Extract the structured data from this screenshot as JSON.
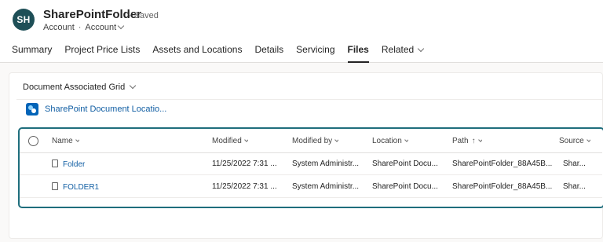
{
  "header": {
    "avatar_initials": "SH",
    "title": "SharePointFolder",
    "saved_status": "- Saved",
    "entity": "Account",
    "form": "Account"
  },
  "tabs": [
    {
      "label": "Summary"
    },
    {
      "label": "Project Price Lists"
    },
    {
      "label": "Assets and Locations"
    },
    {
      "label": "Details"
    },
    {
      "label": "Servicing"
    },
    {
      "label": "Files",
      "active": true
    },
    {
      "label": "Related"
    }
  ],
  "section": {
    "grid_title": "Document Associated Grid",
    "location_link": "SharePoint Document Locatio..."
  },
  "grid": {
    "columns": {
      "name": "Name",
      "modified": "Modified",
      "modified_by": "Modified by",
      "location": "Location",
      "path": "Path",
      "path_sort": "↑",
      "source": "Source"
    },
    "rows": [
      {
        "name": "Folder",
        "modified": "11/25/2022 7:31 ...",
        "modified_by": "System Administr...",
        "location": "SharePoint Docu...",
        "path": "SharePointFolder_88A45B...",
        "source": "Shar..."
      },
      {
        "name": "FOLDER1",
        "modified": "11/25/2022 7:31 ...",
        "modified_by": "System Administr...",
        "location": "SharePoint Docu...",
        "path": "SharePointFolder_88A45B...",
        "source": "Shar..."
      }
    ]
  },
  "colors": {
    "accent": "#1f6e7d",
    "avatar": "#1e4f57",
    "link": "#115ea3"
  }
}
